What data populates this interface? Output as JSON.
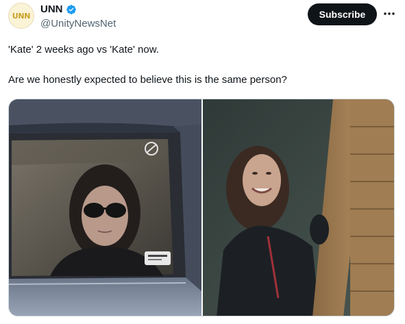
{
  "account": {
    "avatar_text": "UNN",
    "display_name": "UNN",
    "handle": "@UnityNewsNet",
    "verified_icon": "verified-badge-icon"
  },
  "actions": {
    "subscribe_label": "Subscribe",
    "more_icon": "more-options-icon"
  },
  "tweet": {
    "line1": "'Kate' 2 weeks ago vs 'Kate' now.",
    "line2": "Are we honestly expected to believe this is the same person?"
  },
  "media": {
    "images": [
      "photo-woman-in-car-sunglasses",
      "photo-woman-smiling-outdoors"
    ]
  },
  "colors": {
    "accent_blue": "#1d9bf0",
    "button_black": "#0f1419",
    "secondary_text": "#536471",
    "avatar_gold": "#c9a227"
  }
}
